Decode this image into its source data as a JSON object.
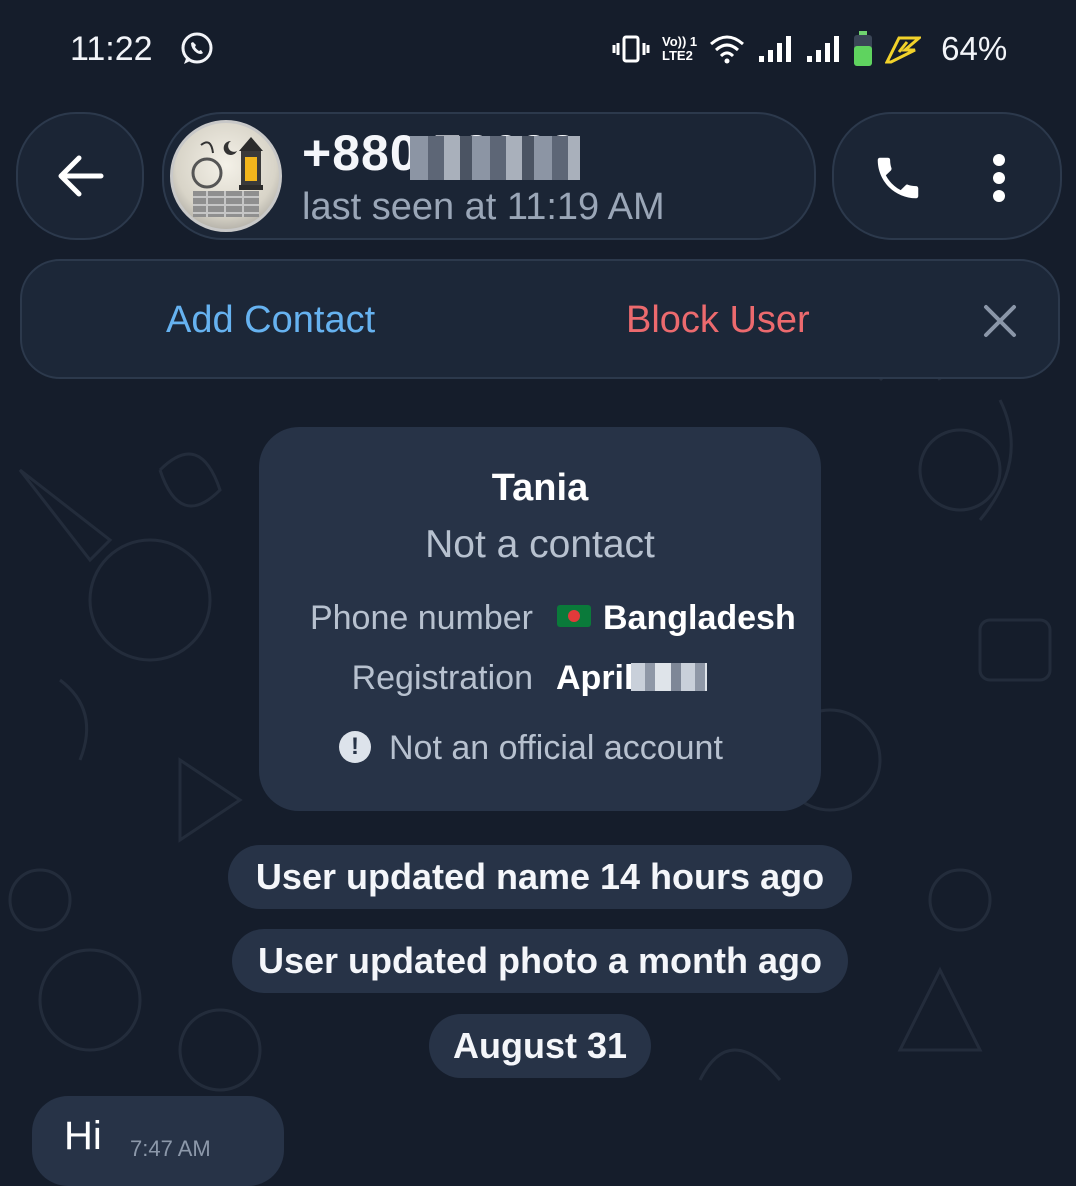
{
  "status_bar": {
    "time": "11:22",
    "app_icon": "whatsapp-icon",
    "icons": [
      "vibrate-icon",
      "volte-icon",
      "wifi-icon",
      "signal-icon",
      "signal-icon",
      "battery-icon",
      "charging-icon"
    ],
    "lte_top": "Vo)) 1",
    "lte_bottom": "LTE2",
    "battery": "64%"
  },
  "header": {
    "back_icon": "back-arrow-icon",
    "name": "+880 78628",
    "last_seen": "last seen at 11:19 AM",
    "call_icon": "phone-icon",
    "menu_icon": "more-vert-icon"
  },
  "action_bar": {
    "add_contact": "Add Contact",
    "block_user": "Block User",
    "close_icon": "close-icon"
  },
  "info_card": {
    "name": "Tania",
    "subtitle": "Not a contact",
    "phone_label": "Phone number",
    "phone_value": "Bangladesh",
    "registration_label": "Registration",
    "registration_value": "April",
    "official_text": "Not an official account"
  },
  "service_messages": [
    "User updated name 14 hours ago",
    "User updated photo a month ago",
    "August 31"
  ],
  "message": {
    "text": "Hi",
    "time": "7:47 AM"
  },
  "colors": {
    "background": "#151d2b",
    "card": "#273347",
    "accent_blue": "#66b2f0",
    "danger_red": "#ec6a6e"
  }
}
